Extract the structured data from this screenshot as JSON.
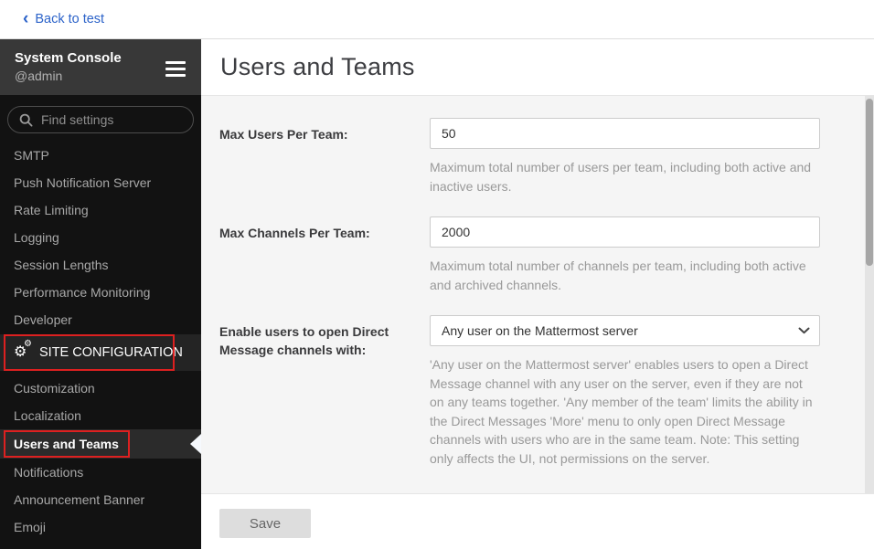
{
  "topbar": {
    "back_label": "Back to test",
    "back_chevron": "‹"
  },
  "sidebar": {
    "title": "System Console",
    "subtitle": "@admin",
    "search_placeholder": "Find settings",
    "items_top": [
      "SMTP",
      "Push Notification Server",
      "Rate Limiting",
      "Logging",
      "Session Lengths",
      "Performance Monitoring",
      "Developer"
    ],
    "category_label": "SITE CONFIGURATION",
    "items_bottom": [
      "Customization",
      "Localization",
      "Users and Teams",
      "Notifications",
      "Announcement Banner",
      "Emoji"
    ],
    "active_item": "Users and Teams",
    "annotated_items": [
      "SITE CONFIGURATION",
      "Users and Teams"
    ]
  },
  "icons": {
    "gear_big": "⚙",
    "gear_small": "⚙"
  },
  "main": {
    "title": "Users and Teams",
    "fields": [
      {
        "label": "Max Users Per Team:",
        "type": "text",
        "value": "50",
        "help": "Maximum total number of users per team, including both active and inactive users."
      },
      {
        "label": "Max Channels Per Team:",
        "type": "text",
        "value": "2000",
        "help": "Maximum total number of channels per team, including both active and archived channels."
      },
      {
        "label": "Enable users to open Direct Message channels with:",
        "type": "select",
        "value": "Any user on the Mattermost server",
        "help": "'Any user on the Mattermost server' enables users to open a Direct Message channel with any user on the server, even if they are not on any teams together. 'Any member of the team' limits the ability in the Direct Messages 'More' menu to only open Direct Message channels with users who are in the same team. Note: This setting only affects the UI, not permissions on the server."
      }
    ],
    "save_label": "Save"
  },
  "colors": {
    "annotation_red": "#dd2020",
    "link_blue": "#2c63c9",
    "sidebar_bg": "#121212",
    "sidebar_header_bg": "#383838",
    "active_item_bg": "#2b2b2b",
    "panel_bg": "#f5f5f5",
    "save_button_bg": "#dddddd"
  }
}
